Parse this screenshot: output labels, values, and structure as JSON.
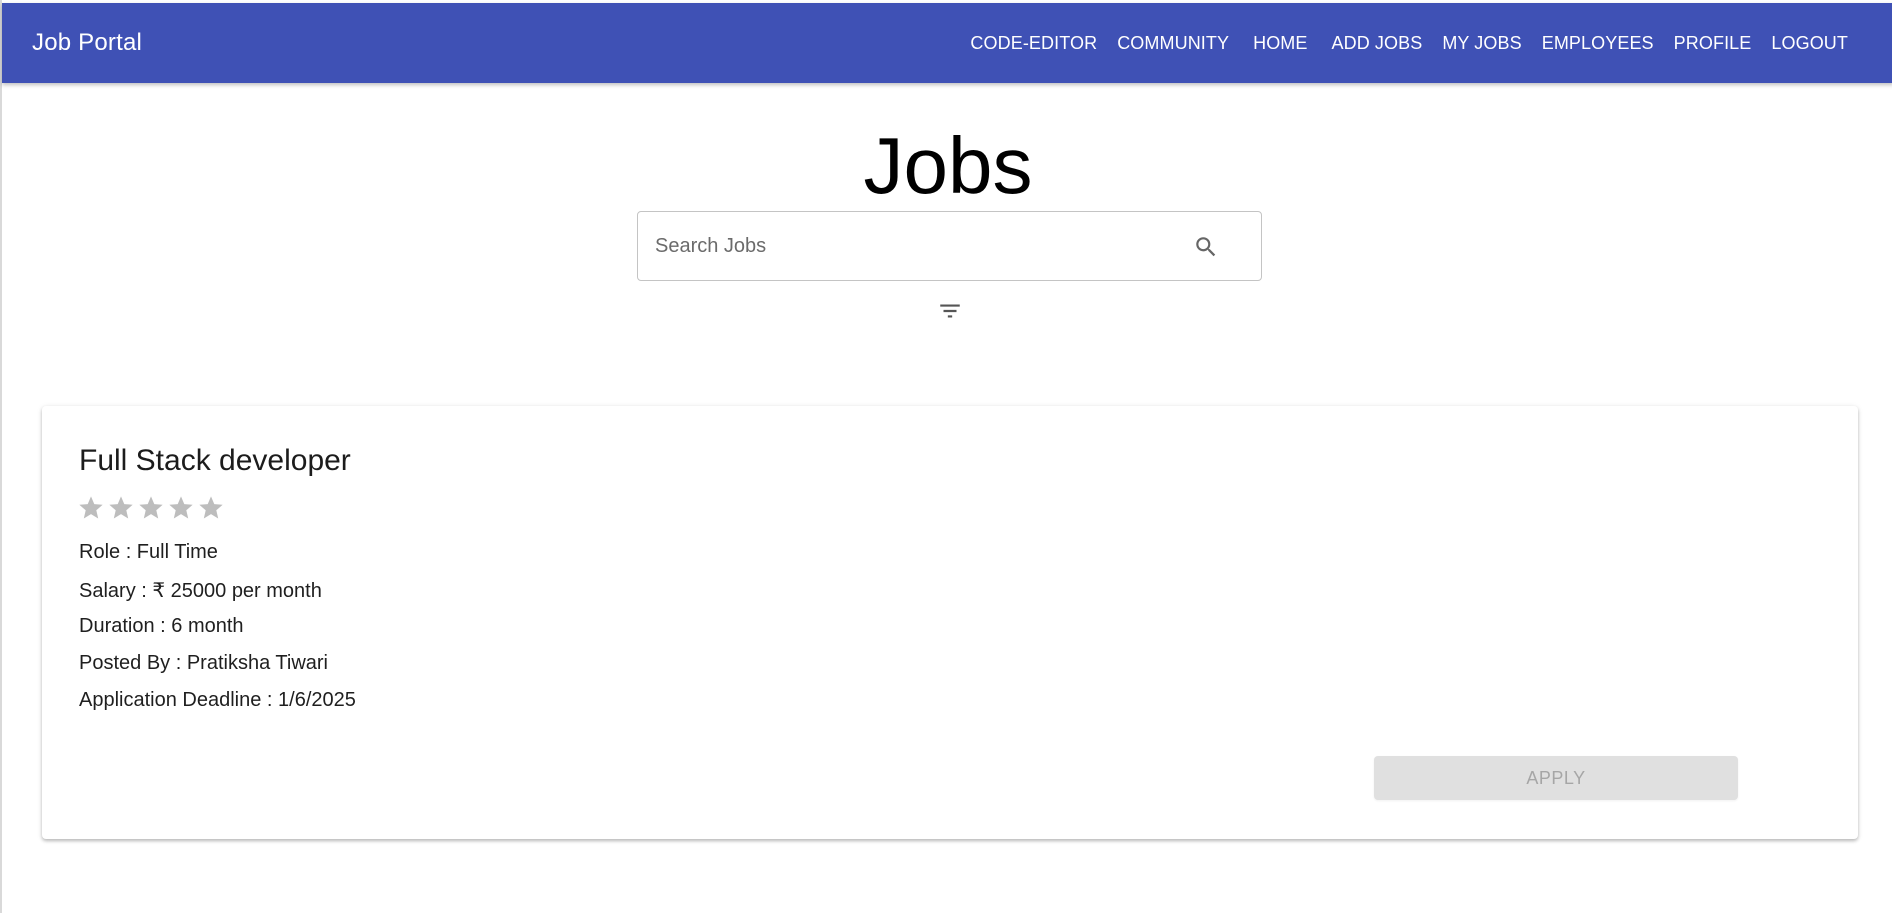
{
  "app": {
    "brand": "Job Portal",
    "nav": [
      "CODE-EDITOR",
      "COMMUNITY",
      "HOME",
      "ADD JOBS",
      "MY JOBS",
      "EMPLOYEES",
      "PROFILE",
      "LOGOUT"
    ]
  },
  "colors": {
    "appbar": "#3f51b5",
    "star_empty": "#bdbdbd",
    "apply_disabled_bg": "#e0e0e0"
  },
  "page": {
    "title": "Jobs",
    "search": {
      "placeholder": "Search Jobs",
      "value": ""
    },
    "icons": {
      "search": "search-icon",
      "filter": "filter-icon"
    }
  },
  "job": {
    "title": "Full Stack developer",
    "rating": {
      "value": 0,
      "max": 5
    },
    "role": "Role : Full Time",
    "salary": "Salary : ₹ 25000 per month",
    "duration": "Duration : 6 month",
    "posted_by": "Posted By : Pratiksha Tiwari",
    "deadline": "Application Deadline : 1/6/2025",
    "apply_label": "APPLY"
  }
}
